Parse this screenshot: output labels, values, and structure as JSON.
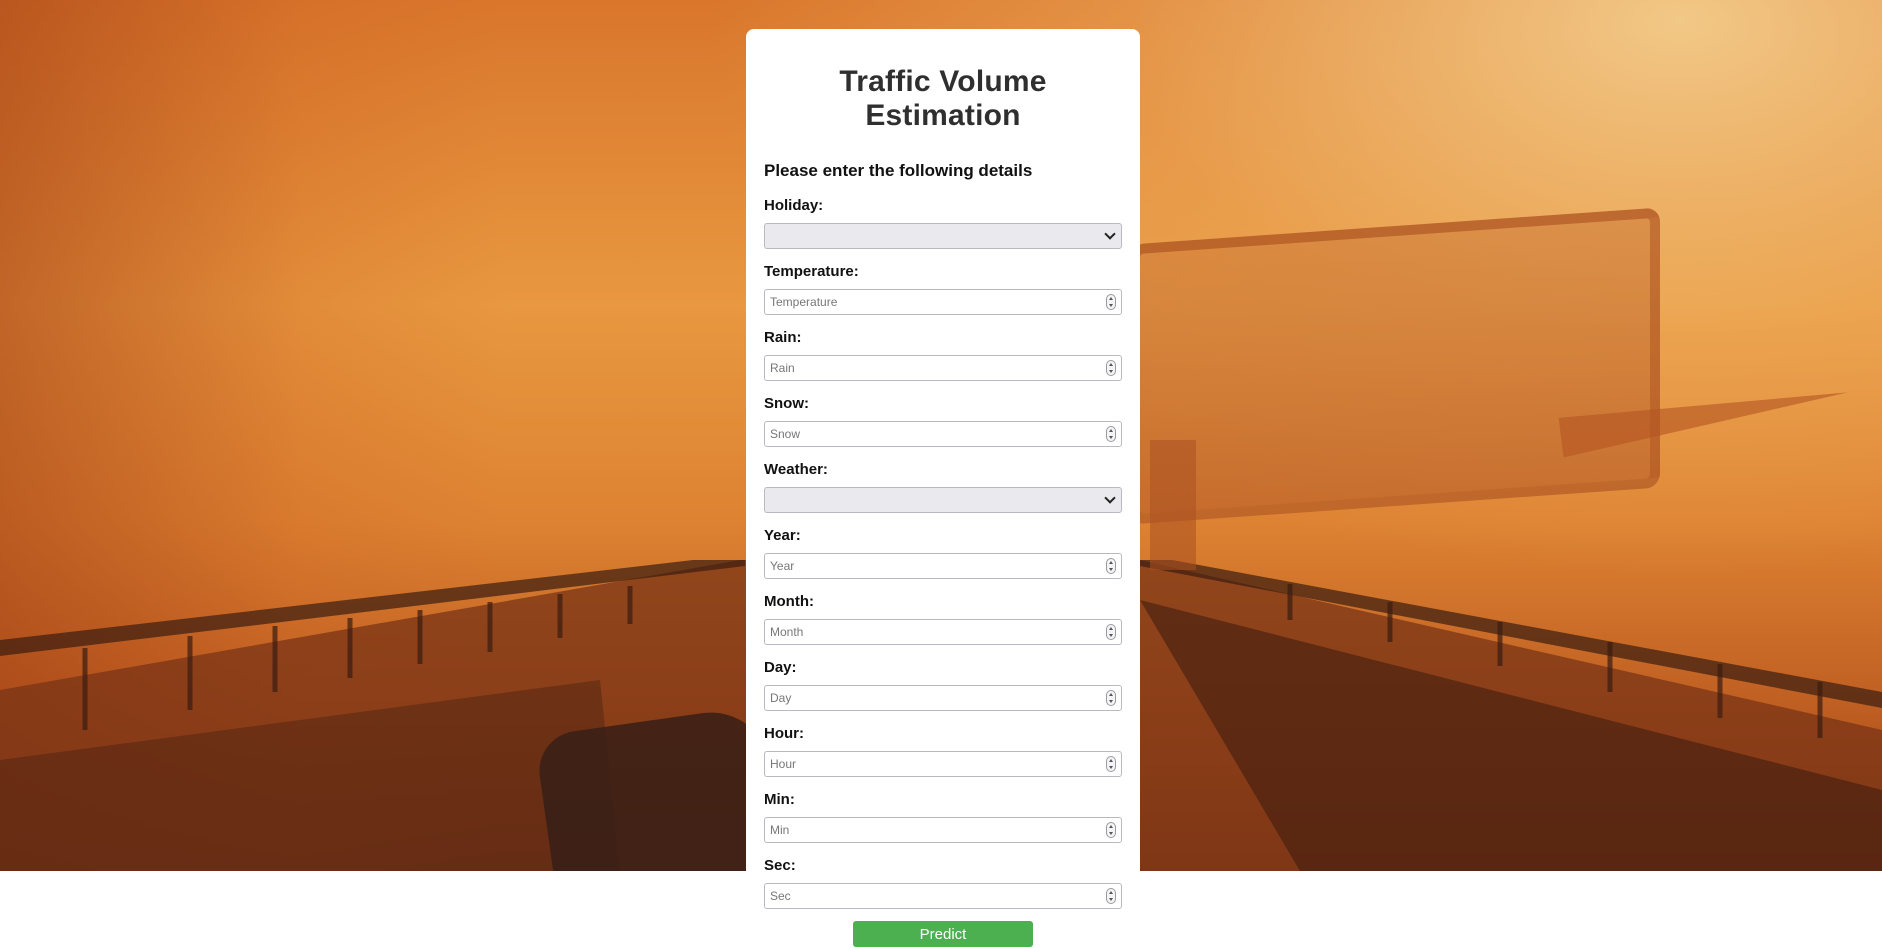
{
  "colors": {
    "accent_button": "#4caf50",
    "panel_background": "#ffffff",
    "page_background": "#e08a36"
  },
  "form": {
    "title": "Traffic Volume Estimation",
    "subtitle": "Please enter the following details",
    "fields": {
      "holiday": {
        "label": "Holiday:",
        "value": ""
      },
      "temperature": {
        "label": "Temperature:",
        "placeholder": "Temperature"
      },
      "rain": {
        "label": "Rain:",
        "placeholder": "Rain"
      },
      "snow": {
        "label": "Snow:",
        "placeholder": "Snow"
      },
      "weather": {
        "label": "Weather:",
        "value": ""
      },
      "year": {
        "label": "Year:",
        "placeholder": "Year"
      },
      "month": {
        "label": "Month:",
        "placeholder": "Month"
      },
      "day": {
        "label": "Day:",
        "placeholder": "Day"
      },
      "hour": {
        "label": "Hour:",
        "placeholder": "Hour"
      },
      "min": {
        "label": "Min:",
        "placeholder": "Min"
      },
      "sec": {
        "label": "Sec:",
        "placeholder": "Sec"
      }
    },
    "submit_label": "Predict"
  },
  "icons": {
    "select_arrow": "chevron-down-icon",
    "number_spinner": "spinner-icon"
  }
}
